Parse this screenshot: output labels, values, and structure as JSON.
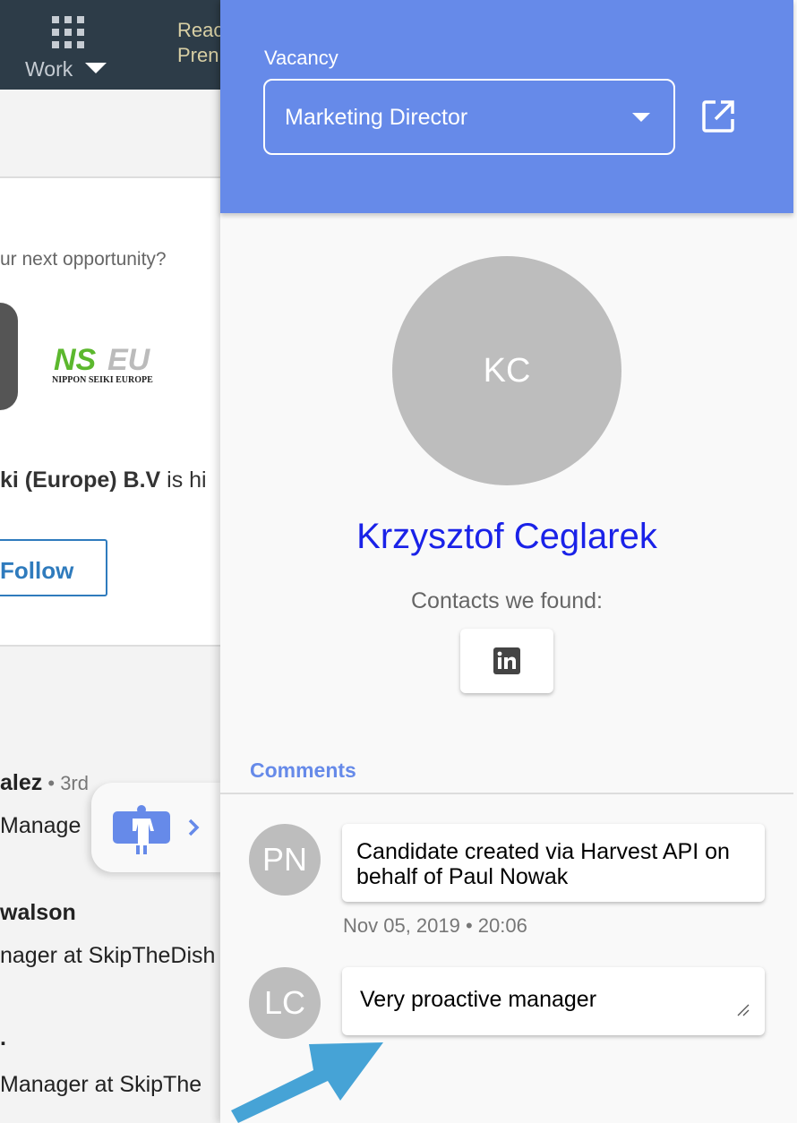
{
  "linkedin": {
    "work_label": "Work",
    "read_label": "Reac\nPren",
    "opportunity_text": "ur next opportunity?",
    "company_logo_text": "NSEU NIPPON SEIKI EUROPE",
    "company_text": "ki (Europe) B.V",
    "company_suffix": " is hi",
    "follow_label": "Follow",
    "people": [
      {
        "name": "alez",
        "degree": " • 3rd",
        "title": " Manage"
      },
      {
        "name": "walson",
        "title": "nager at SkipTheDish"
      },
      {
        "name": ".",
        "title": "Manager at SkipThe"
      }
    ]
  },
  "panel": {
    "vacancy_label": "Vacancy",
    "vacancy_value": "Marketing Director",
    "candidate_initials": "KC",
    "candidate_name": "Krzysztof Ceglarek",
    "contacts_label": "Contacts we found:",
    "comments_title": "Comments",
    "comments": [
      {
        "initials": "PN",
        "text": "Candidate created via Harvest API on behalf of Paul Nowak",
        "date": "Nov 05, 2019 • 20:06"
      },
      {
        "initials": "LC",
        "text": "Very proactive manager"
      }
    ]
  },
  "colors": {
    "accent": "#668ae9",
    "name_link": "#1a22e8",
    "arrow": "#46a3d6"
  }
}
